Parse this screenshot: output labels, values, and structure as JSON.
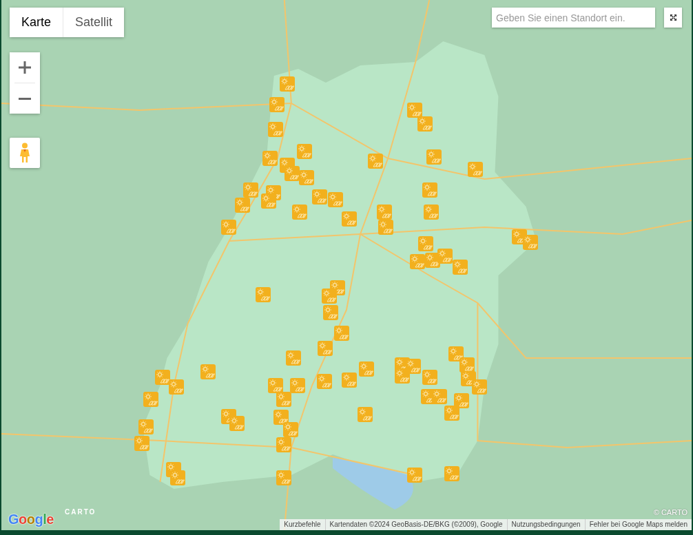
{
  "map_type_tabs": [
    {
      "label": "Karte",
      "selected": true
    },
    {
      "label": "Satellit",
      "selected": false
    }
  ],
  "search": {
    "placeholder": "Geben Sie einen Standort ein."
  },
  "logos": {
    "google": "Google",
    "carto": "CARTO"
  },
  "copyright": "© CARTO",
  "attribution": [
    "Kurzbefehle",
    "Kartendaten ©2024 GeoBasis-DE/BKG (©2009), Google",
    "Nutzungsbedingungen",
    "Fehler bei Google Maps melden"
  ]
}
